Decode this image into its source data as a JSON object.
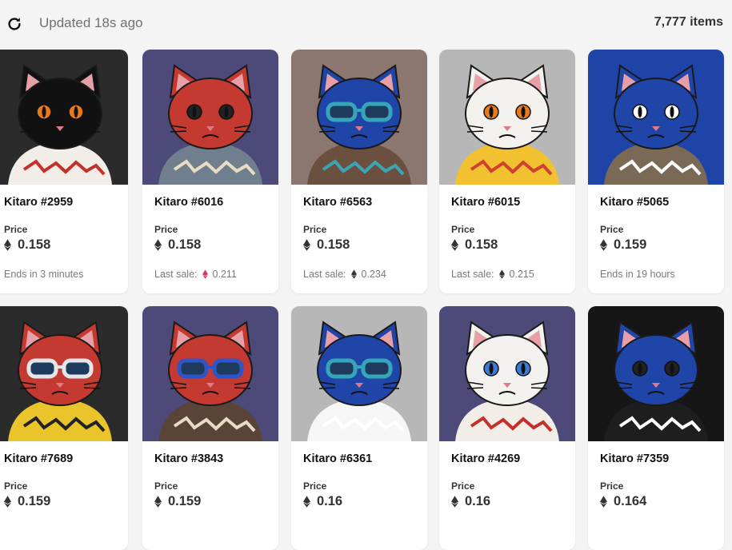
{
  "header": {
    "refresh_icon": "refresh-icon",
    "updated_text": "Updated 18s ago",
    "item_count": "7,777 items"
  },
  "price_label": "Price",
  "cards": [
    {
      "name": "Kitaro #2959",
      "price": "0.158",
      "footer_text": "Ends in 3 minutes",
      "last_sale": "",
      "last_sale_currency": "",
      "bg": "#2b2b2b",
      "fur": "#111111",
      "eyes": "#e87a1b",
      "shirt": "#f2ede6",
      "accent": "#c4302b",
      "glasses": "none"
    },
    {
      "name": "Kitaro #6016",
      "price": "0.158",
      "footer_text": "Last sale:",
      "last_sale": "0.211",
      "last_sale_currency": "weth",
      "bg": "#4d4a7a",
      "fur": "#c53a30",
      "eyes": "#222",
      "shirt": "#6f7f8d",
      "accent": "#e8ddc4",
      "glasses": "none"
    },
    {
      "name": "Kitaro #6563",
      "price": "0.158",
      "footer_text": "Last sale:",
      "last_sale": "0.234",
      "last_sale_currency": "eth",
      "bg": "#8b7670",
      "fur": "#2045a8",
      "eyes": "#222",
      "shirt": "#6b5040",
      "accent": "#3aa6b5",
      "glasses": "teal"
    },
    {
      "name": "Kitaro #6015",
      "price": "0.158",
      "footer_text": "Last sale:",
      "last_sale": "0.215",
      "last_sale_currency": "eth",
      "bg": "#b7b7b7",
      "fur": "#f4f2ee",
      "eyes": "#e87a1b",
      "shirt": "#f2c130",
      "accent": "#d04030",
      "glasses": "none"
    },
    {
      "name": "Kitaro #5065",
      "price": "0.159",
      "footer_text": "Ends in 19 hours",
      "last_sale": "",
      "last_sale_currency": "",
      "bg": "#1d44a6",
      "fur": "#2045a8",
      "eyes": "#fff",
      "shirt": "#7a6a55",
      "accent": "#ffffff",
      "glasses": "none"
    },
    {
      "name": "Kitaro #7689",
      "price": "0.159",
      "footer_text": "",
      "last_sale": "",
      "last_sale_currency": "",
      "bg": "#2b2b2b",
      "fur": "#c53a30",
      "eyes": "#222",
      "shirt": "#e9c42b",
      "accent": "#222",
      "glasses": "white"
    },
    {
      "name": "Kitaro #3843",
      "price": "0.159",
      "footer_text": "",
      "last_sale": "",
      "last_sale_currency": "",
      "bg": "#4d4a7a",
      "fur": "#c53a30",
      "eyes": "#222",
      "shirt": "#5a4438",
      "accent": "#e8ddc4",
      "glasses": "blue"
    },
    {
      "name": "Kitaro #6361",
      "price": "0.16",
      "footer_text": "",
      "last_sale": "",
      "last_sale_currency": "",
      "bg": "#b7b7b7",
      "fur": "#2045a8",
      "eyes": "#222",
      "shirt": "#f6f6f6",
      "accent": "#ffffff",
      "glasses": "teal"
    },
    {
      "name": "Kitaro #4269",
      "price": "0.16",
      "footer_text": "",
      "last_sale": "",
      "last_sale_currency": "",
      "bg": "#4d4a7a",
      "fur": "#f4f2ee",
      "eyes": "#3a7bd5",
      "shirt": "#f2ede6",
      "accent": "#c4302b",
      "glasses": "none"
    },
    {
      "name": "Kitaro #7359",
      "price": "0.164",
      "footer_text": "",
      "last_sale": "",
      "last_sale_currency": "",
      "bg": "#161616",
      "fur": "#2045a8",
      "eyes": "#222",
      "shirt": "#1e1e1e",
      "accent": "#ffffff",
      "glasses": "none"
    }
  ]
}
